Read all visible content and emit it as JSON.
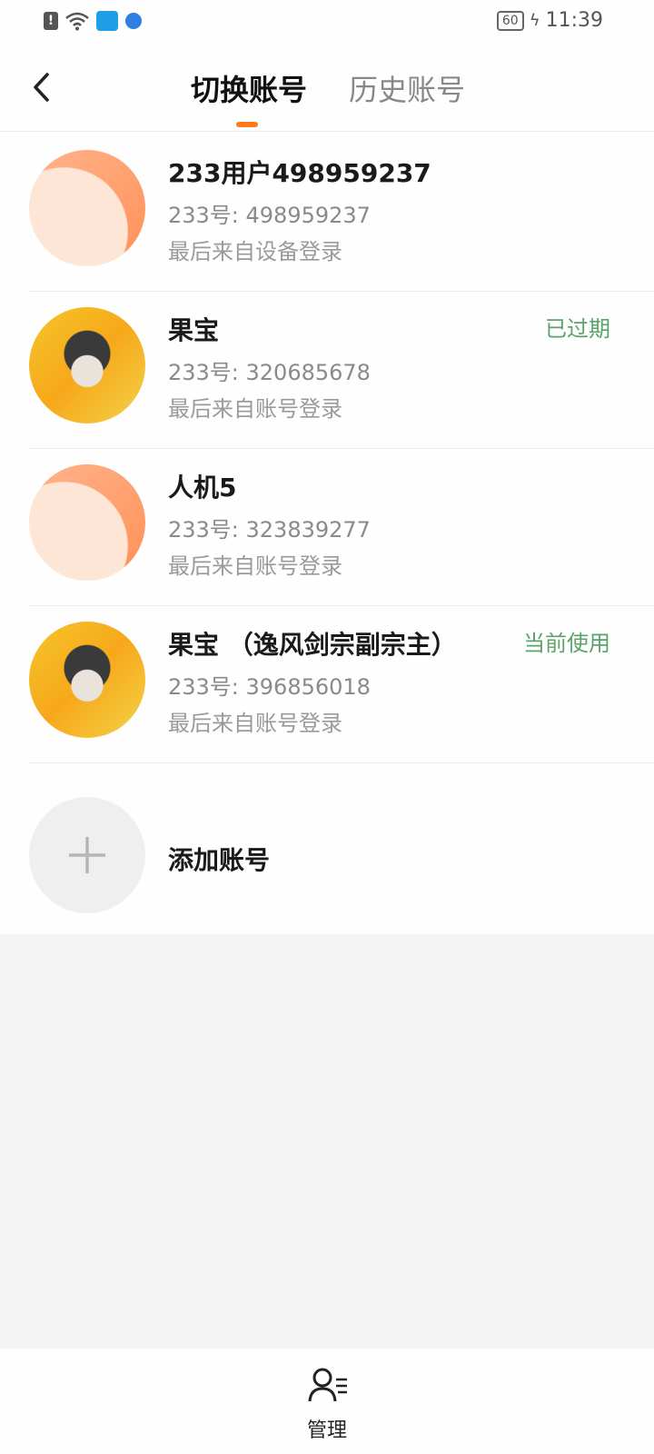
{
  "status_bar": {
    "battery": "60",
    "time": "11:39"
  },
  "header": {
    "tabs": [
      {
        "label": "切换账号",
        "active": true
      },
      {
        "label": "历史账号",
        "active": false
      }
    ],
    "accent_color": "#ff7a1c"
  },
  "accounts": [
    {
      "name": "233用户498959237",
      "id_line": "233号: 498959237",
      "last_login": "最后来自设备登录",
      "status": "",
      "avatar": "default-avatar"
    },
    {
      "name": "果宝",
      "id_line": "233号: 320685678",
      "last_login": "最后来自账号登录",
      "status": "已过期",
      "avatar": "game-avatar"
    },
    {
      "name": "人机5",
      "id_line": "233号: 323839277",
      "last_login": "最后来自账号登录",
      "status": "",
      "avatar": "default-avatar"
    },
    {
      "name": "果宝 （逸风剑宗副宗主）",
      "id_line": "233号: 396856018",
      "last_login": "最后来自账号登录",
      "status": "当前使用",
      "avatar": "game-avatar"
    }
  ],
  "add_account": {
    "label": "添加账号",
    "icon": "plus-icon"
  },
  "bottom_nav": {
    "label": "管理",
    "icon": "user-manage-icon"
  },
  "status_color": "#5aa36a"
}
